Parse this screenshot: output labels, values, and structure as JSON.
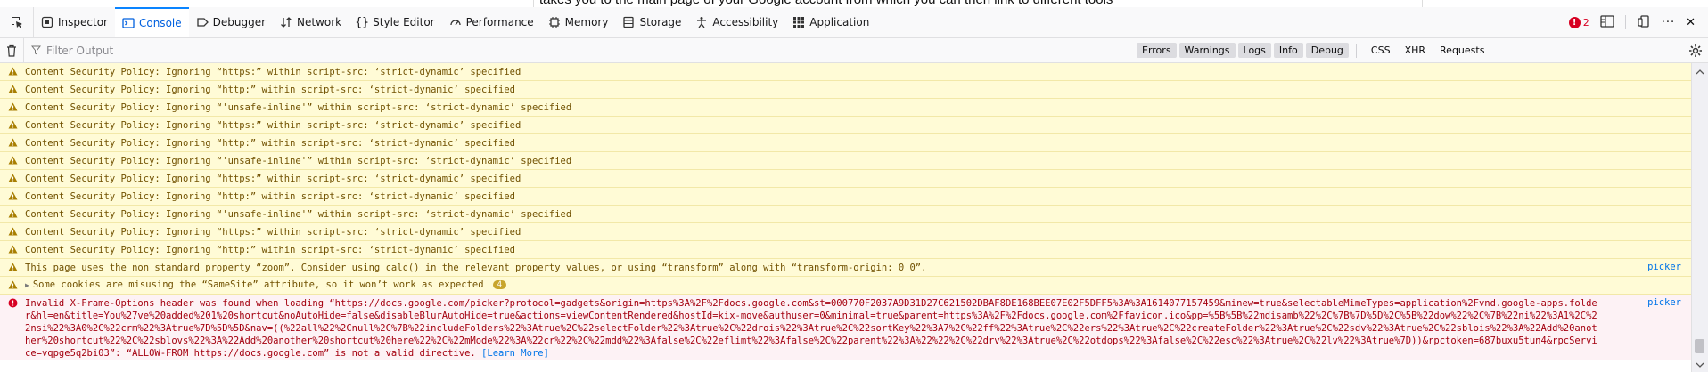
{
  "page": {
    "visible_text": "takes you to the main page of your Google account from which you can then link to different tools"
  },
  "toolbar": {
    "tabs": [
      {
        "label": "Inspector",
        "icon": "inspector-icon"
      },
      {
        "label": "Console",
        "icon": "console-icon",
        "selected": true
      },
      {
        "label": "Debugger",
        "icon": "debugger-icon"
      },
      {
        "label": "Network",
        "icon": "network-icon"
      },
      {
        "label": "Style Editor",
        "icon": "style-editor-icon"
      },
      {
        "label": "Performance",
        "icon": "performance-icon"
      },
      {
        "label": "Memory",
        "icon": "memory-icon"
      },
      {
        "label": "Storage",
        "icon": "storage-icon"
      },
      {
        "label": "Accessibility",
        "icon": "accessibility-icon"
      },
      {
        "label": "Application",
        "icon": "application-icon"
      }
    ],
    "error_count": "2",
    "more_label": "···",
    "close_label": "✕"
  },
  "filterbar": {
    "placeholder": "Filter Output",
    "levels": [
      "Errors",
      "Warnings",
      "Logs",
      "Info",
      "Debug"
    ],
    "network": [
      "CSS",
      "XHR",
      "Requests"
    ]
  },
  "messages": [
    {
      "type": "warn",
      "text": "Content Security Policy: Ignoring “https:” within script-src: ‘strict-dynamic’ specified"
    },
    {
      "type": "warn",
      "text": "Content Security Policy: Ignoring “http:” within script-src: ‘strict-dynamic’ specified"
    },
    {
      "type": "warn",
      "text": "Content Security Policy: Ignoring “'unsafe-inline'” within script-src: ‘strict-dynamic’ specified"
    },
    {
      "type": "warn",
      "text": "Content Security Policy: Ignoring “https:” within script-src: ‘strict-dynamic’ specified"
    },
    {
      "type": "warn",
      "text": "Content Security Policy: Ignoring “http:” within script-src: ‘strict-dynamic’ specified"
    },
    {
      "type": "warn",
      "text": "Content Security Policy: Ignoring “'unsafe-inline'” within script-src: ‘strict-dynamic’ specified"
    },
    {
      "type": "warn",
      "text": "Content Security Policy: Ignoring “https:” within script-src: ‘strict-dynamic’ specified"
    },
    {
      "type": "warn",
      "text": "Content Security Policy: Ignoring “http:” within script-src: ‘strict-dynamic’ specified"
    },
    {
      "type": "warn",
      "text": "Content Security Policy: Ignoring “'unsafe-inline'” within script-src: ‘strict-dynamic’ specified"
    },
    {
      "type": "warn",
      "text": "Content Security Policy: Ignoring “https:” within script-src: ‘strict-dynamic’ specified"
    },
    {
      "type": "warn",
      "text": "Content Security Policy: Ignoring “http:” within script-src: ‘strict-dynamic’ specified"
    },
    {
      "type": "warn",
      "text": "This page uses the non standard property “zoom”. Consider using calc() in the relevant property values, or using “transform” along with “transform-origin: 0 0”.",
      "source": "picker"
    },
    {
      "type": "group",
      "text": "Some cookies are misusing the “SameSite” attribute, so it won’t work as expected",
      "count": "4"
    },
    {
      "type": "error",
      "text": "Invalid X-Frame-Options header was found when loading “https://docs.google.com/picker?protocol=gadgets&origin=https%3A%2F%2Fdocs.google.com&st=000770F2037A9D31D27C621502DBAF8DE168BEE07E02F5DFF5%3A%3A1614077157459&minew=true&selectableMimeTypes=application%2Fvnd.google-apps.folder&hl=en&title=You%27ve%20added%201%20shortcut&noAutoHide=false&disableBlurAutoHide=true&actions=viewContentRendered&hostId=kix-move&authuser=0&minimal=true&parent=https%3A%2F%2Fdocs.google.com%2Ffavicon.ico&pp=%5B%5B%22mdisamb%22%2C%7B%7D%5D%2C%5B%22dow%22%2C%7B%22ni%22%3A1%2C%22nsi%22%3A0%2C%22crm%22%3Atrue%7D%5D%5D&nav=((%22all%22%2Cnull%2C%7B%22includeFolders%22%3Atrue%2C%22selectFolder%22%3Atrue%2C%22drois%22%3Atrue%2C%22sortKey%22%3A7%2C%22ff%22%3Atrue%2C%22ers%22%3Atrue%2C%22createFolder%22%3Atrue%2C%22sdv%22%3Atrue%2C%22sblois%22%3A%22Add%20another%20shortcut%22%2C%22sblovs%22%3A%22Add%20another%20shortcut%20here%22%2C%22mMode%22%3A%22cr%22%2C%22mdd%22%3Afalse%2C%22eflimt%22%3Afalse%2C%22parent%22%3A%22%22%2C%22drv%22%3Atrue%2C%22otdops%22%3Afalse%2C%22esc%22%3Atrue%2C%22lv%22%3Atrue%7D))&rpctoken=687buxu5tun4&rpcService=vqpge5q2bi03”: “ALLOW-FROM https://docs.google.com” is not a valid directive. ",
      "learn_more": "[Learn More]",
      "source": "picker"
    }
  ]
}
